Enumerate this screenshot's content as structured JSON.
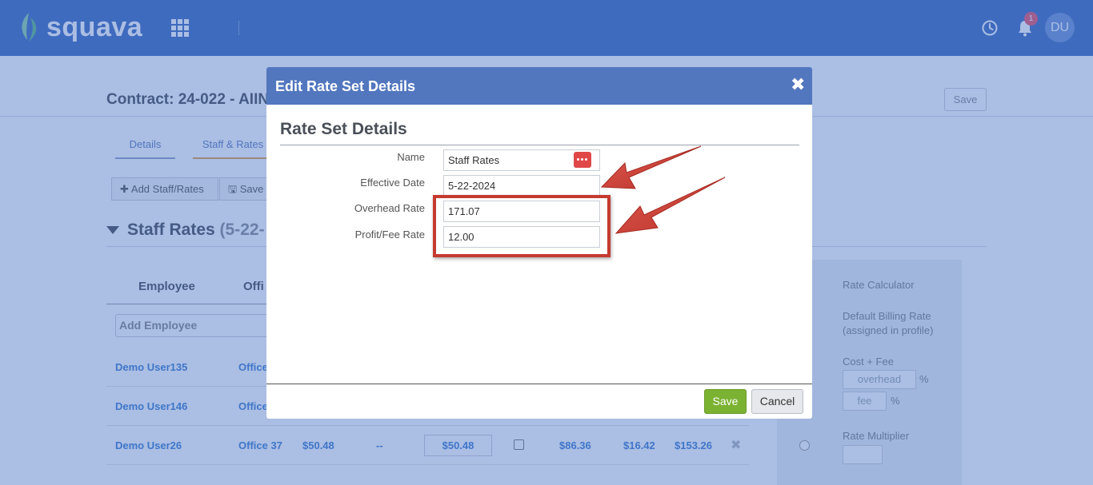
{
  "app": {
    "brand": "squava",
    "notification_count": "1",
    "user_initials": "DU"
  },
  "page": {
    "contract_title": "Contract: 24-022 - AIIN",
    "save_label": "Save",
    "tabs": [
      {
        "label": "Details"
      },
      {
        "label": "Staff & Rates"
      }
    ],
    "toolbar": {
      "add_label": "Add Staff/Rates",
      "save_label": "Save"
    },
    "section": {
      "title": "Staff Rates",
      "dates": "(5-22-"
    },
    "columns": {
      "employee": "Employee",
      "office": "Offi"
    },
    "add_employee_placeholder": "Add Employee",
    "rows": [
      {
        "name": "Demo User135",
        "office": "Office",
        "rate": "",
        "dash": "",
        "billing": "",
        "a": "",
        "b": "",
        "c": ""
      },
      {
        "name": "Demo User146",
        "office": "Office",
        "rate": "",
        "dash": "",
        "billing": "",
        "a": "",
        "b": "",
        "c": ""
      },
      {
        "name": "Demo User26",
        "office": "Office 37",
        "rate": "$50.48",
        "dash": "--",
        "billing": "$50.48",
        "a": "$86.36",
        "b": "$16.42",
        "c": "$153.26"
      }
    ],
    "calculator": {
      "title": "Rate Calculator",
      "default_line1": "Default Billing Rate",
      "default_line2": "(assigned in profile)",
      "cost_fee": "Cost + Fee",
      "overhead_placeholder": "overhead",
      "fee_placeholder": "fee",
      "percent": "%",
      "multiplier": "Rate Multiplier"
    }
  },
  "modal": {
    "title": "Edit Rate Set Details",
    "subtitle": "Rate Set Details",
    "fields": {
      "name_label": "Name",
      "name_value": "Staff Rates",
      "effective_label": "Effective Date",
      "effective_value": "5-22-2024",
      "overhead_label": "Overhead Rate",
      "overhead_value": "171.07",
      "profit_label": "Profit/Fee Rate",
      "profit_value": "12.00"
    },
    "save_label": "Save",
    "cancel_label": "Cancel"
  },
  "colors": {
    "header_blue": "#5277bf",
    "save_green": "#7bb232",
    "annotation_red": "#c53a2f",
    "link_blue": "#3f7fd0"
  }
}
